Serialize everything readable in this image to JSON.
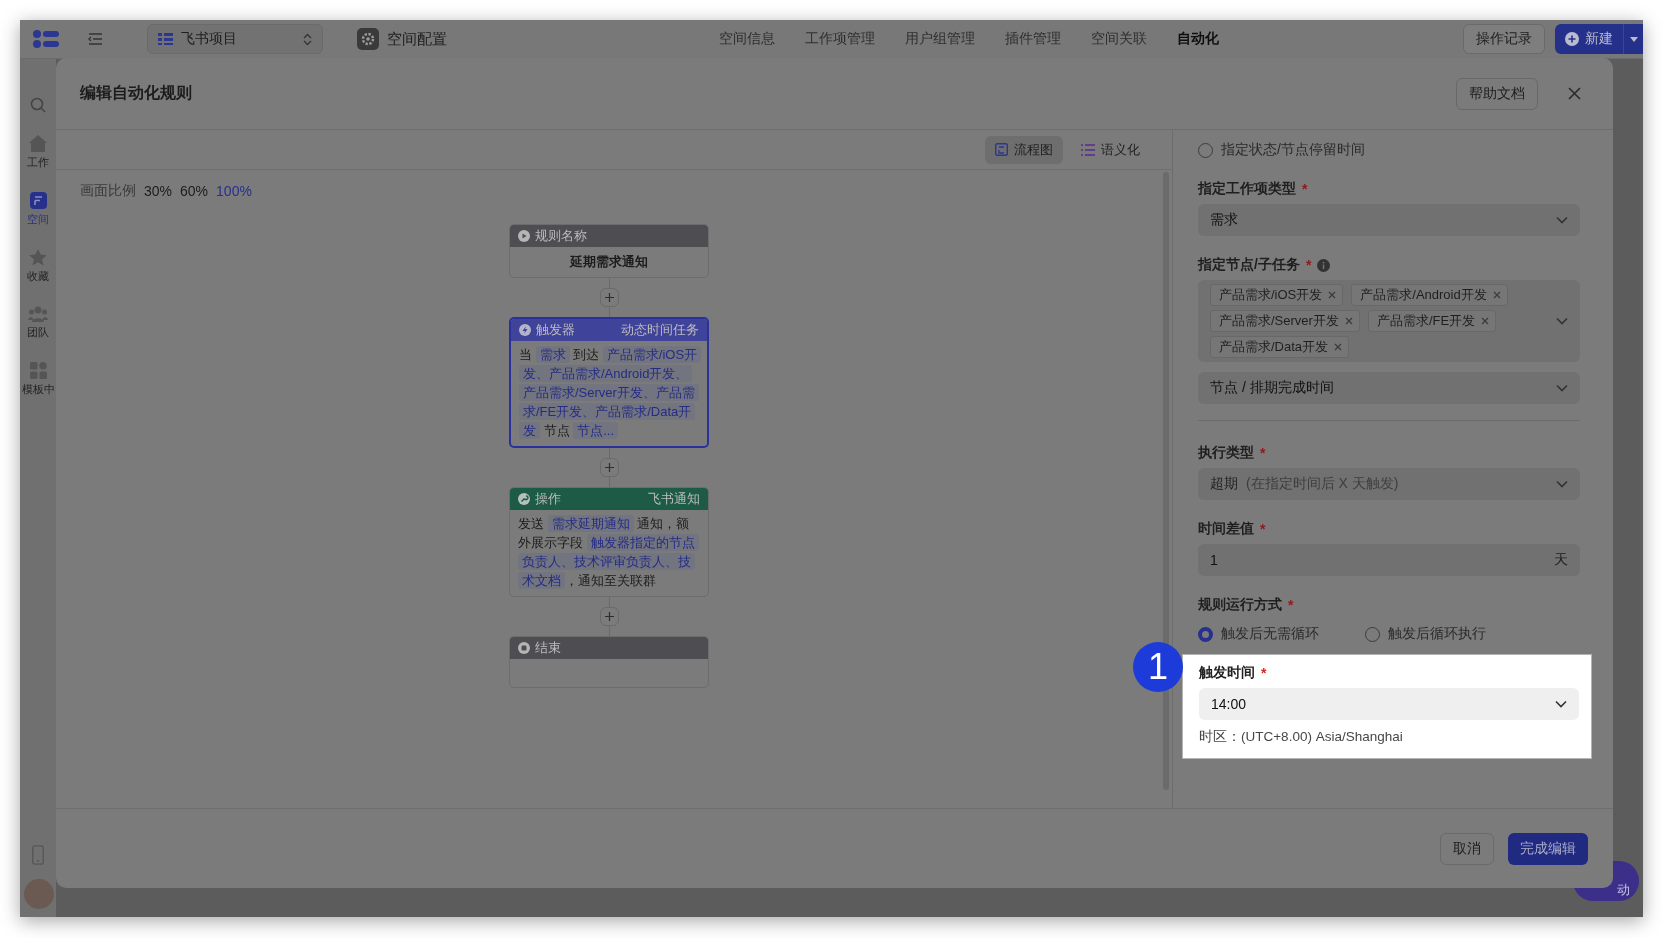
{
  "top_bar": {
    "space_name": "飞书项目",
    "page_title": "空间配置",
    "tabs": [
      {
        "label": "空间信息",
        "selected": false
      },
      {
        "label": "工作项管理",
        "selected": false
      },
      {
        "label": "用户组管理",
        "selected": false
      },
      {
        "label": "插件管理",
        "selected": false
      },
      {
        "label": "空间关联",
        "selected": false
      },
      {
        "label": "自动化",
        "selected": true
      }
    ],
    "history_button": "操作记录",
    "new_button": "新建"
  },
  "sidebar": {
    "items": [
      {
        "kind": "home",
        "label": "工作",
        "selected": false
      },
      {
        "kind": "space",
        "label": "空间",
        "selected": true
      },
      {
        "kind": "star",
        "label": "收藏",
        "selected": false
      },
      {
        "kind": "team",
        "label": "团队",
        "selected": false
      },
      {
        "kind": "grid",
        "label": "模板中",
        "selected": false
      }
    ]
  },
  "help_float": {
    "label": "动"
  },
  "modal": {
    "title": "编辑自动化规则",
    "help_button": "帮助文档",
    "view_tabs": [
      {
        "kind": "flow",
        "label": "流程图",
        "selected": true
      },
      {
        "kind": "list",
        "label": "语义化",
        "selected": false
      }
    ],
    "zoom": {
      "label": "画面比例",
      "options": [
        {
          "label": "30%",
          "selected": false
        },
        {
          "label": "60%",
          "selected": false
        },
        {
          "label": "100%",
          "selected": true
        }
      ]
    },
    "flow_nodes": [
      {
        "kind": "start",
        "title": "规则名称",
        "body": [
          {
            "kind": "text",
            "text": "延期需求通知"
          }
        ]
      },
      {
        "kind": "trigger",
        "title": "触发器",
        "subtitle": "动态时间任务",
        "body": [
          {
            "kind": "text",
            "text": "当 "
          },
          {
            "kind": "chip",
            "text": "需求"
          },
          {
            "kind": "text",
            "text": " 到达 "
          },
          {
            "kind": "chip",
            "text": "产品需求/iOS开发、产品需求/Android开发、产品需求/Server开发、产品需求/FE开发、产品需求/Data开发"
          },
          {
            "kind": "text",
            "text": " 节点 "
          },
          {
            "kind": "chip",
            "text": "节点..."
          }
        ]
      },
      {
        "kind": "action",
        "title": "操作",
        "subtitle": "飞书通知",
        "body": [
          {
            "kind": "text",
            "text": "发送 "
          },
          {
            "kind": "chip",
            "text": "需求延期通知"
          },
          {
            "kind": "text",
            "text": " 通知，额外展示字段 "
          },
          {
            "kind": "chip",
            "text": "触发器指定的节点负责人、技术评审负责人、技术文档"
          },
          {
            "kind": "text",
            "text": "，通知至关联群"
          }
        ]
      },
      {
        "kind": "end",
        "title": "结束"
      }
    ],
    "form": {
      "stay_option": {
        "label": "指定状态/节点停留时间",
        "checked": false
      },
      "work_item_type": {
        "label": "指定工作项类型",
        "required_mark": "*",
        "value": "需求"
      },
      "nodes": {
        "label": "指定节点/子任务",
        "required_mark": "*",
        "info": true,
        "tags": [
          "产品需求/iOS开发",
          "产品需求/Android开发",
          "产品需求/Server开发",
          "产品需求/FE开发",
          "产品需求/Data开发"
        ],
        "time_field": "节点 / 排期完成时间"
      },
      "execution_type": {
        "label": "执行类型",
        "required_mark": "*",
        "value": "超期",
        "hint": "(在指定时间后 X 天触发)"
      },
      "time_diff": {
        "label": "时间差值",
        "required_mark": "*",
        "value": "1",
        "unit": "天"
      },
      "run_mode": {
        "label": "规则运行方式",
        "required_mark": "*",
        "options": [
          {
            "label": "触发后无需循环",
            "selected": true
          },
          {
            "label": "触发后循环执行",
            "selected": false
          }
        ]
      },
      "trigger_time": {
        "label": "触发时间",
        "required_mark": "*",
        "value": "14:00",
        "timezone": "时区：(UTC+8.00) Asia/Shanghai",
        "callout": "1"
      }
    },
    "footer": {
      "cancel": "取消",
      "confirm": "完成编辑"
    }
  }
}
